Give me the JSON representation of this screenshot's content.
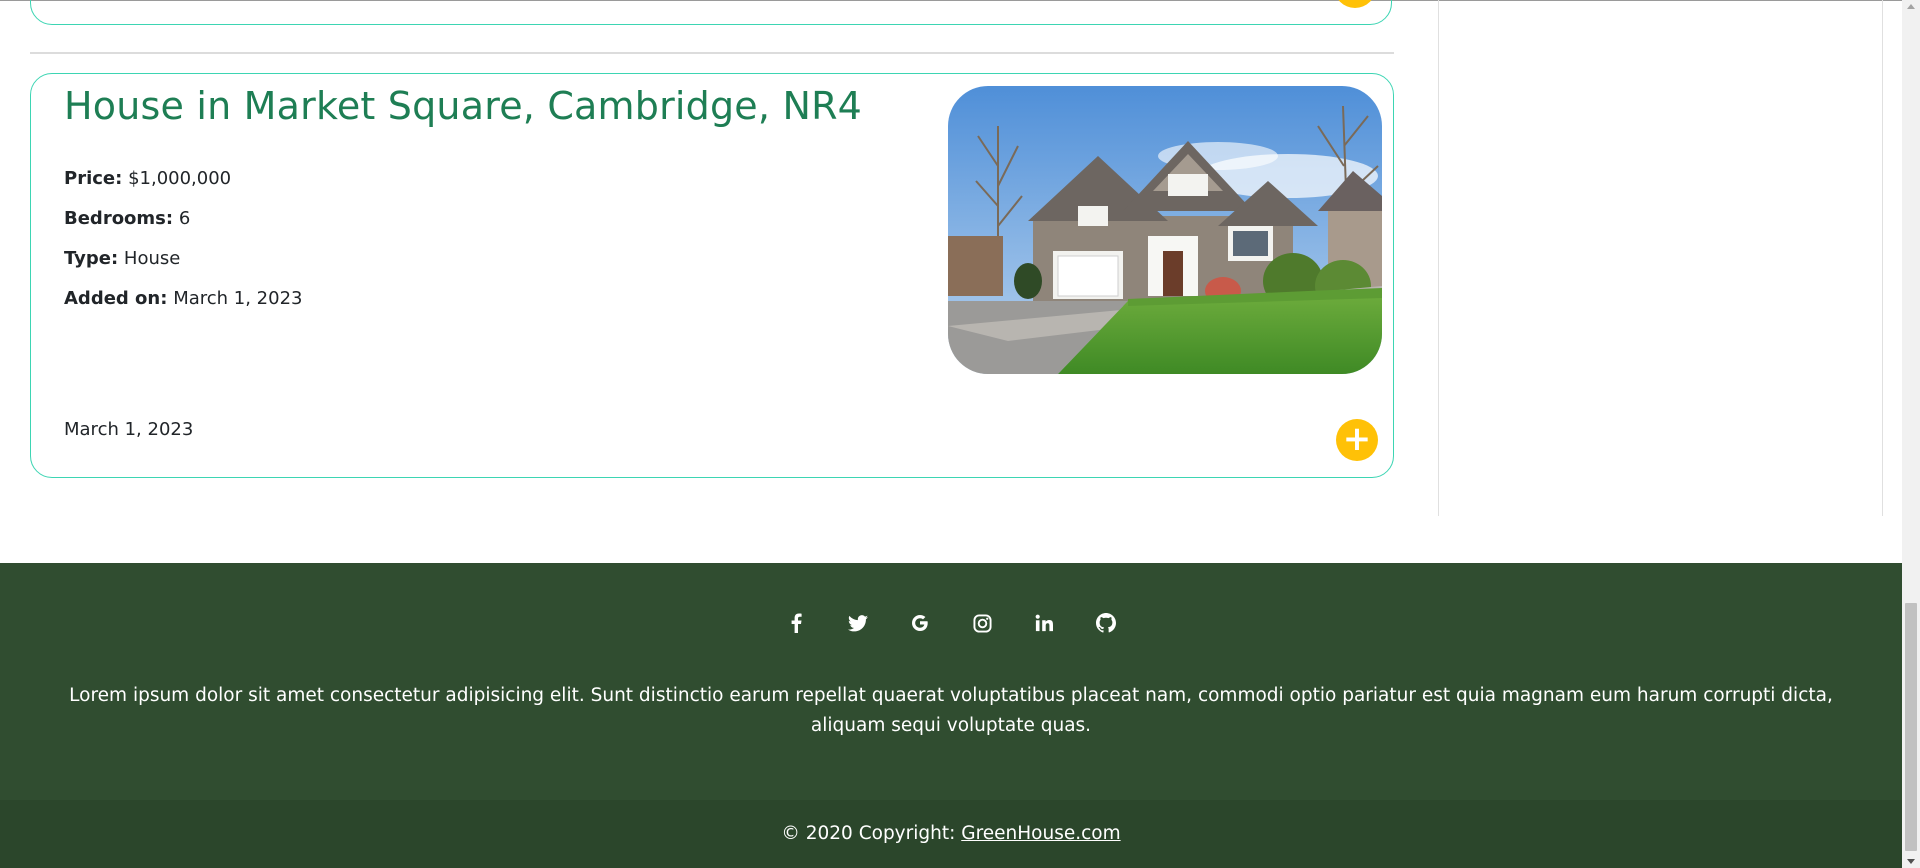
{
  "listing": {
    "title": "House in Market Square, Cambridge, NR4",
    "price_label": "Price:",
    "price_value": "$1,000,000",
    "bedrooms_label": "Bedrooms:",
    "bedrooms_value": "6",
    "type_label": "Type:",
    "type_value": "House",
    "added_label": "Added on:",
    "added_value": "March 1, 2023",
    "footer_date": "March 1, 2023",
    "add_button_icon": "plus-icon",
    "image_icon": "house-photo"
  },
  "footer": {
    "social_icons": [
      "facebook-icon",
      "twitter-icon",
      "google-icon",
      "instagram-icon",
      "linkedin-icon",
      "github-icon"
    ],
    "text": "Lorem ipsum dolor sit amet consectetur adipisicing elit. Sunt distinctio earum repellat quaerat voluptatibus placeat nam, commodi optio pariatur est quia magnam eum harum corrupti dicta, aliquam sequi voluptate quas.",
    "copyright_prefix": "© 2020 Copyright:",
    "copyright_link": "GreenHouse.com"
  },
  "colors": {
    "title_green": "#1e7e54",
    "card_border": "#3dd5b3",
    "add_button": "#ffc107",
    "footer_bg": "#304d30",
    "copyright_bg": "#2b462b"
  }
}
